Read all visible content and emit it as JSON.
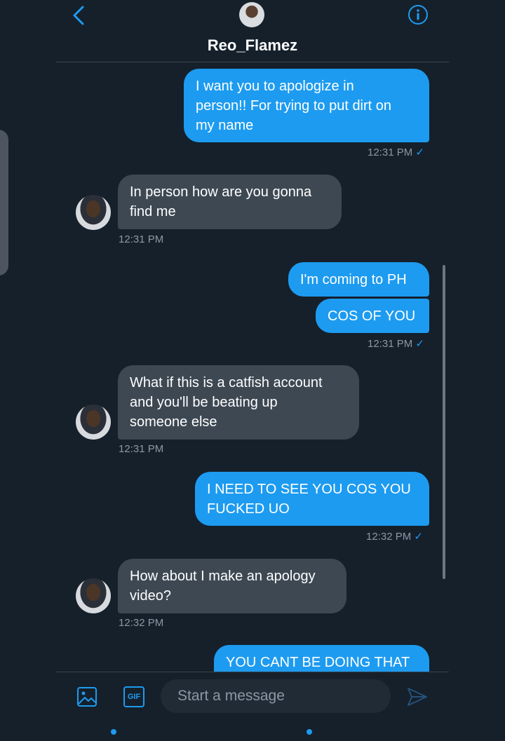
{
  "header": {
    "title": "Reo_Flamez"
  },
  "composer": {
    "placeholder": "Start a message",
    "gif_label": "GIF"
  },
  "messages": [
    {
      "dir": "out",
      "text": "I want you to apologize in\nperson!! For trying to put dirt on\nmy name",
      "time": "12:31 PM"
    },
    {
      "dir": "in",
      "text": "In person how are you gonna\nfind me",
      "time": "12:31 PM"
    },
    {
      "dir": "out",
      "text": "I'm coming to PH"
    },
    {
      "dir": "out",
      "text": "COS OF YOU",
      "time": "12:31 PM"
    },
    {
      "dir": "in",
      "text": "What if this is a catfish account\nand you'll be beating up\nsomeone else",
      "time": "12:31 PM"
    },
    {
      "dir": "out",
      "text": "I NEED TO SEE YOU COS YOU\nFUCKED UO",
      "time": "12:32 PM"
    },
    {
      "dir": "in",
      "text": "How about I make an apology\nvideo?",
      "time": "12:32 PM"
    },
    {
      "dir": "out",
      "text": "YOU CANT BE DOING THAT"
    }
  ],
  "colors": {
    "background": "#15202b",
    "outgoing": "#1d9bf0",
    "incoming": "#3d4853",
    "timestamp": "#8b98a5"
  }
}
